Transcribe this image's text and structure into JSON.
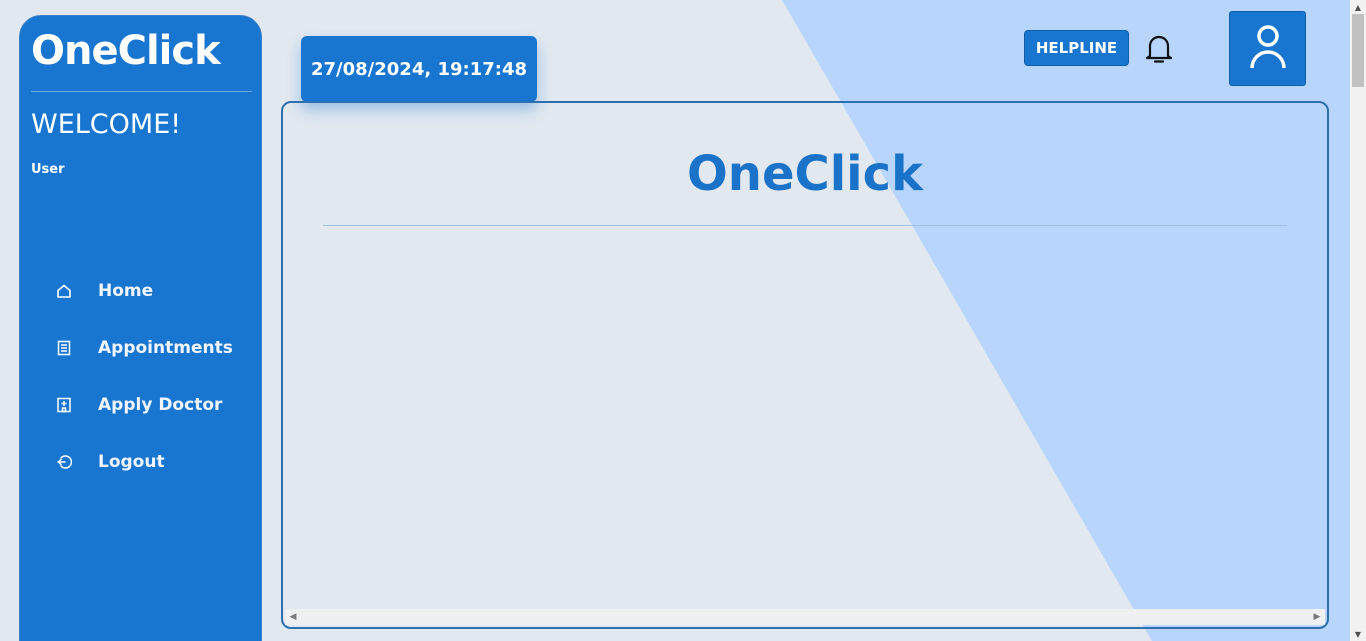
{
  "sidebar": {
    "brand": "OneClick",
    "welcome": "WELCOME!",
    "username": "User",
    "items": [
      {
        "label": "Home",
        "icon": "home-icon"
      },
      {
        "label": "Appointments",
        "icon": "list-icon"
      },
      {
        "label": "Apply Doctor",
        "icon": "hospital-icon"
      },
      {
        "label": "Logout",
        "icon": "logout-icon"
      }
    ]
  },
  "header": {
    "datetime": "27/08/2024, 19:17:48",
    "helpline_label": "HELPLINE",
    "bell_icon": "bell-icon",
    "profile_icon": "user-icon"
  },
  "main": {
    "title": "OneClick"
  },
  "colors": {
    "primary": "#1976d0",
    "background": "#e1e8f0",
    "accent_wedge": "#b8d6fd",
    "title": "#1a73c8"
  }
}
